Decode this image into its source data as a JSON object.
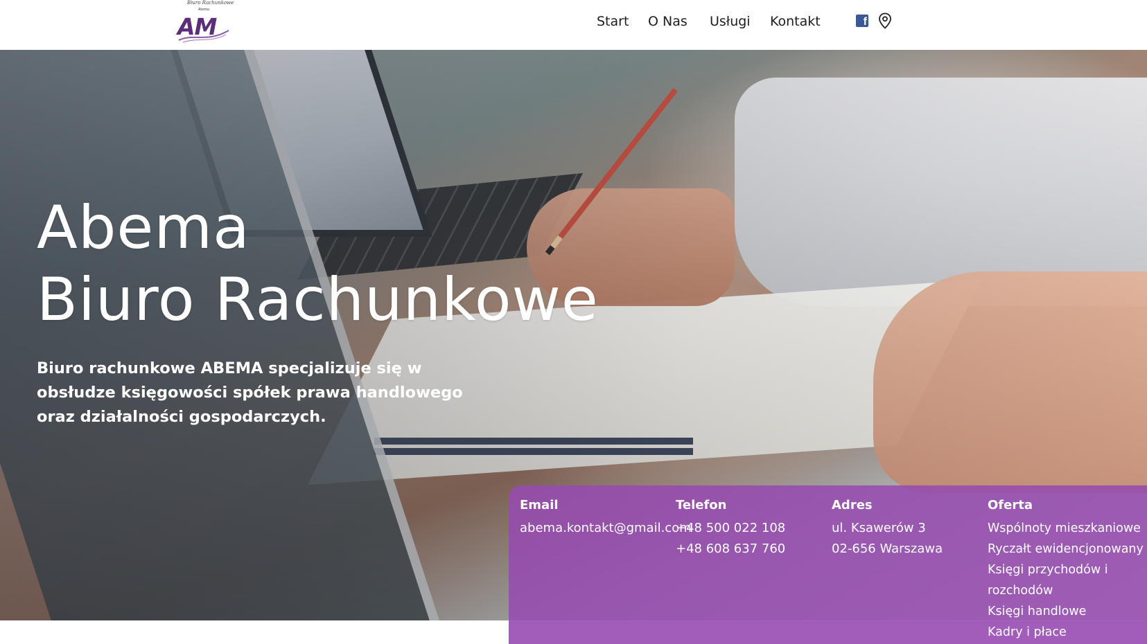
{
  "header": {
    "logo": {
      "top_text": "Biuro Rachunkowe",
      "sub_text": "Abema",
      "mark_text": "AM"
    },
    "nav": [
      {
        "label": "Start"
      },
      {
        "label": "O Nas"
      },
      {
        "label": "Usługi"
      },
      {
        "label": "Kontakt"
      }
    ],
    "icons": [
      "facebook-icon",
      "map-pin-icon"
    ]
  },
  "hero": {
    "title_line1": "Abema",
    "title_line2": "Biuro Rachunkowe",
    "description": "Biuro rachunkowe ABEMA specjalizuje się w obsłudze księgowości spółek prawa handlowego oraz działalności gospodarczych."
  },
  "info": {
    "email": {
      "heading": "Email",
      "value": "abema.kontakt@gmail.com"
    },
    "telefon": {
      "heading": "Telefon",
      "phones": [
        "+48 500 022 108",
        "+48 608 637 760"
      ]
    },
    "adres": {
      "heading": "Adres",
      "lines": [
        "ul. Ksawerów 3",
        "02-656 Warszawa"
      ]
    },
    "oferta": {
      "heading": "Oferta",
      "items": [
        "Wspólnoty mieszkaniowe",
        "Ryczałt ewidencjonowany",
        "Księgi przychodów i",
        "rozchodów",
        "Księgi handlowe",
        "Kadry i płace"
      ]
    }
  },
  "colors": {
    "accent_purple": "#964baf",
    "facebook_blue": "#3b5998",
    "nav_text": "#1d1d1d"
  }
}
